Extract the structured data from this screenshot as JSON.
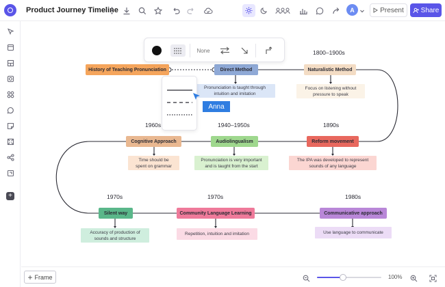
{
  "app": {
    "title": "Product Journey Timeline",
    "present_label": "Present",
    "share_label": "Share",
    "avatar_initial": "A",
    "accent_color": "#5a55e8"
  },
  "toolbar_icons": [
    "more-icon",
    "download-icon",
    "search-icon",
    "star-icon",
    "undo-icon",
    "redo-icon",
    "cloud-icon",
    "sun-icon",
    "moon-icon",
    "collaborators-icon",
    "chart-icon",
    "comment-icon",
    "share-arrow-icon",
    "chevron-down-icon"
  ],
  "sidebar_icons": [
    "pointer-icon",
    "frame-icon",
    "template-icon",
    "shape-icon",
    "component-icon",
    "chat-icon",
    "sticky-note-icon",
    "image-icon",
    "connector-icon",
    "embed-icon",
    "add-icon"
  ],
  "floating_toolbar": {
    "line_color": "#111111",
    "arrow_label": "None",
    "line_style_options": [
      "solid",
      "dashed",
      "dotted"
    ]
  },
  "cursor": {
    "label": "Anna",
    "color": "#2f7de1"
  },
  "timeline": {
    "nodes": [
      {
        "id": "history",
        "title": "History of Teaching Pronunciation",
        "color": "#f5a55c"
      },
      {
        "id": "direct",
        "era": "",
        "title": "Direct Method",
        "color": "#8fa9d6",
        "desc": [
          "Pronunciation is taught through",
          "intuition and imitation"
        ],
        "desc_color": "#dbe6f7"
      },
      {
        "id": "naturalistic",
        "era": "1800–1900s",
        "title": "Naturalistic Method",
        "color": "#f3dcc4",
        "desc": [
          "Focus on listening without",
          "pressure to speak"
        ],
        "desc_color": "#fbf3e7"
      },
      {
        "id": "reform",
        "era": "1890s",
        "title": "Reform movement",
        "color": "#e8685e",
        "desc": [
          "The IPA was developed to represent",
          "sounds of any language"
        ],
        "desc_color": "#fbd6d2"
      },
      {
        "id": "audio",
        "era": "1940–1950s",
        "title": "Audiolingualism",
        "color": "#9fd88e",
        "desc": [
          "Pronunciation is very important",
          "and is taught from the start"
        ],
        "desc_color": "#d9f1d0"
      },
      {
        "id": "cognitive",
        "era": "1960s",
        "title": "Cognitive Approach",
        "color": "#e9b891",
        "desc": [
          "Time should be",
          "spent on grammar"
        ],
        "desc_color": "#fbe4d2"
      },
      {
        "id": "silent",
        "era": "1970s",
        "title": "Silent way",
        "color": "#5ab78a",
        "desc": [
          "Accuracy of production of",
          "sounds and structure"
        ],
        "desc_color": "#cfeede"
      },
      {
        "id": "community",
        "era": "1970s",
        "title": "Community Language Learning",
        "color": "#ef7a9a",
        "desc": [
          "Repetition, intuition and imitation"
        ],
        "desc_color": "#fbdbe5"
      },
      {
        "id": "communicative",
        "era": "1980s",
        "title": "Communicative approach",
        "color": "#b987d8",
        "desc": [
          "Use language to communicate"
        ],
        "desc_color": "#ecdcf6"
      }
    ]
  },
  "bottom": {
    "frame_label": "Frame",
    "zoom_label": "100%",
    "zoom_level": 0.4
  }
}
